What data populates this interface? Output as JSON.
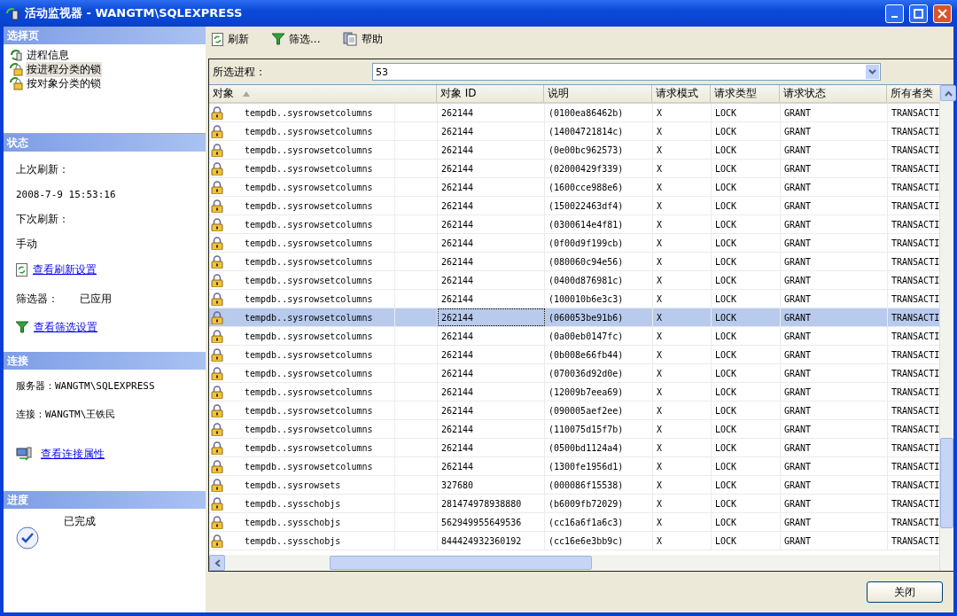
{
  "window": {
    "title": "活动监视器 - WANGTM\\SQLEXPRESS"
  },
  "sidebar": {
    "select_page": {
      "heading": "选择页",
      "items": [
        {
          "label": "进程信息",
          "kind": "process",
          "selected": false
        },
        {
          "label": "按进程分类的锁",
          "kind": "lock",
          "selected": true
        },
        {
          "label": "按对象分类的锁",
          "kind": "lock",
          "selected": false
        }
      ]
    },
    "status": {
      "heading": "状态",
      "last_refresh_label": "上次刷新：",
      "last_refresh": "2008-7-9 15:53:16",
      "next_refresh_label": "下次刷新：",
      "next_refresh": "手动",
      "refresh_link": "查看刷新设置",
      "filter_label": "筛选器：",
      "filter_value": "已应用",
      "filter_link": "查看筛选设置"
    },
    "connection": {
      "heading": "连接",
      "server": "服务器：WANGTM\\SQLEXPRESS",
      "connection": "连接：WANGTM\\王铁民",
      "link": "查看连接属性"
    },
    "progress": {
      "heading": "进度",
      "status": "已完成"
    }
  },
  "toolbar": [
    {
      "kind": "refresh",
      "label": "刷新"
    },
    {
      "kind": "filter",
      "label": "筛选..."
    },
    {
      "kind": "help",
      "label": "帮助"
    }
  ],
  "process": {
    "label": "所选进程：",
    "value": "53"
  },
  "table": {
    "columns": [
      {
        "label": "对象",
        "sorted": true
      },
      {
        "label": "对象 ID",
        "sorted": false
      },
      {
        "label": "说明",
        "sorted": false
      },
      {
        "label": "请求模式",
        "sorted": false
      },
      {
        "label": "请求类型",
        "sorted": false
      },
      {
        "label": "请求状态",
        "sorted": false
      },
      {
        "label": "所有者类",
        "sorted": false
      }
    ],
    "rows": [
      {
        "cells": [
          "tempdb..sysrowsetcolumns",
          "262144",
          "(0100ea86462b)",
          "X",
          "LOCK",
          "GRANT",
          "TRANSACTI"
        ],
        "selected": false
      },
      {
        "cells": [
          "tempdb..sysrowsetcolumns",
          "262144",
          "(14004721814c)",
          "X",
          "LOCK",
          "GRANT",
          "TRANSACTI"
        ],
        "selected": false
      },
      {
        "cells": [
          "tempdb..sysrowsetcolumns",
          "262144",
          "(0e00bc962573)",
          "X",
          "LOCK",
          "GRANT",
          "TRANSACTI"
        ],
        "selected": false
      },
      {
        "cells": [
          "tempdb..sysrowsetcolumns",
          "262144",
          "(02000429f339)",
          "X",
          "LOCK",
          "GRANT",
          "TRANSACTI"
        ],
        "selected": false
      },
      {
        "cells": [
          "tempdb..sysrowsetcolumns",
          "262144",
          "(1600cce988e6)",
          "X",
          "LOCK",
          "GRANT",
          "TRANSACTI"
        ],
        "selected": false
      },
      {
        "cells": [
          "tempdb..sysrowsetcolumns",
          "262144",
          "(150022463df4)",
          "X",
          "LOCK",
          "GRANT",
          "TRANSACTI"
        ],
        "selected": false
      },
      {
        "cells": [
          "tempdb..sysrowsetcolumns",
          "262144",
          "(0300614e4f81)",
          "X",
          "LOCK",
          "GRANT",
          "TRANSACTI"
        ],
        "selected": false
      },
      {
        "cells": [
          "tempdb..sysrowsetcolumns",
          "262144",
          "(0f00d9f199cb)",
          "X",
          "LOCK",
          "GRANT",
          "TRANSACTI"
        ],
        "selected": false
      },
      {
        "cells": [
          "tempdb..sysrowsetcolumns",
          "262144",
          "(080060c94e56)",
          "X",
          "LOCK",
          "GRANT",
          "TRANSACTI"
        ],
        "selected": false
      },
      {
        "cells": [
          "tempdb..sysrowsetcolumns",
          "262144",
          "(0400d876981c)",
          "X",
          "LOCK",
          "GRANT",
          "TRANSACTI"
        ],
        "selected": false
      },
      {
        "cells": [
          "tempdb..sysrowsetcolumns",
          "262144",
          "(100010b6e3c3)",
          "X",
          "LOCK",
          "GRANT",
          "TRANSACTI"
        ],
        "selected": false
      },
      {
        "cells": [
          "tempdb..sysrowsetcolumns",
          "262144",
          "(060053be91b6)",
          "X",
          "LOCK",
          "GRANT",
          "TRANSACTI"
        ],
        "selected": true
      },
      {
        "cells": [
          "tempdb..sysrowsetcolumns",
          "262144",
          "(0a00eb0147fc)",
          "X",
          "LOCK",
          "GRANT",
          "TRANSACTI"
        ],
        "selected": false
      },
      {
        "cells": [
          "tempdb..sysrowsetcolumns",
          "262144",
          "(0b008e66fb44)",
          "X",
          "LOCK",
          "GRANT",
          "TRANSACTI"
        ],
        "selected": false
      },
      {
        "cells": [
          "tempdb..sysrowsetcolumns",
          "262144",
          "(070036d92d0e)",
          "X",
          "LOCK",
          "GRANT",
          "TRANSACTI"
        ],
        "selected": false
      },
      {
        "cells": [
          "tempdb..sysrowsetcolumns",
          "262144",
          "(12009b7eea69)",
          "X",
          "LOCK",
          "GRANT",
          "TRANSACTI"
        ],
        "selected": false
      },
      {
        "cells": [
          "tempdb..sysrowsetcolumns",
          "262144",
          "(090005aef2ee)",
          "X",
          "LOCK",
          "GRANT",
          "TRANSACTI"
        ],
        "selected": false
      },
      {
        "cells": [
          "tempdb..sysrowsetcolumns",
          "262144",
          "(110075d15f7b)",
          "X",
          "LOCK",
          "GRANT",
          "TRANSACTI"
        ],
        "selected": false
      },
      {
        "cells": [
          "tempdb..sysrowsetcolumns",
          "262144",
          "(0500bd1124a4)",
          "X",
          "LOCK",
          "GRANT",
          "TRANSACTI"
        ],
        "selected": false
      },
      {
        "cells": [
          "tempdb..sysrowsetcolumns",
          "262144",
          "(1300fe1956d1)",
          "X",
          "LOCK",
          "GRANT",
          "TRANSACTI"
        ],
        "selected": false
      },
      {
        "cells": [
          "tempdb..sysrowsets",
          "327680",
          "(000086f15538)",
          "X",
          "LOCK",
          "GRANT",
          "TRANSACTI"
        ],
        "selected": false
      },
      {
        "cells": [
          "tempdb..sysschobjs",
          "281474978938880",
          "(b6009fb72029)",
          "X",
          "LOCK",
          "GRANT",
          "TRANSACTI"
        ],
        "selected": false
      },
      {
        "cells": [
          "tempdb..sysschobjs",
          "562949955649536",
          "(cc16a6f1a6c3)",
          "X",
          "LOCK",
          "GRANT",
          "TRANSACTI"
        ],
        "selected": false
      },
      {
        "cells": [
          "tempdb..sysschobjs",
          "844424932360192",
          "(cc16e6e3bb9c)",
          "X",
          "LOCK",
          "GRANT",
          "TRANSACTI"
        ],
        "selected": false
      }
    ]
  },
  "buttons": [
    {
      "label": "关闭"
    }
  ]
}
